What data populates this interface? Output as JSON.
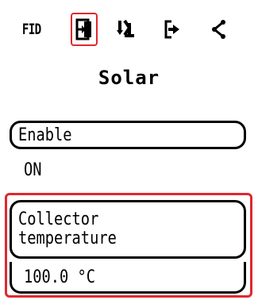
{
  "toolbar": {
    "fid_label": "FID",
    "items": [
      {
        "name": "fid-button",
        "icon": "fid-text"
      },
      {
        "name": "input-button",
        "icon": "login-icon"
      },
      {
        "name": "transfer-button",
        "icon": "sort-arrows-icon"
      },
      {
        "name": "output-button",
        "icon": "logout-icon"
      },
      {
        "name": "share-button",
        "icon": "share-icon"
      }
    ],
    "active_index": 1
  },
  "page": {
    "title": "Solar"
  },
  "enable": {
    "label": "Enable",
    "value": "ON"
  },
  "collector": {
    "label_line1": "Collector",
    "label_line2": "temperature",
    "value": "100.0 °C"
  },
  "colors": {
    "selection": "#e0282e",
    "text": "#000000",
    "background": "#ffffff"
  }
}
